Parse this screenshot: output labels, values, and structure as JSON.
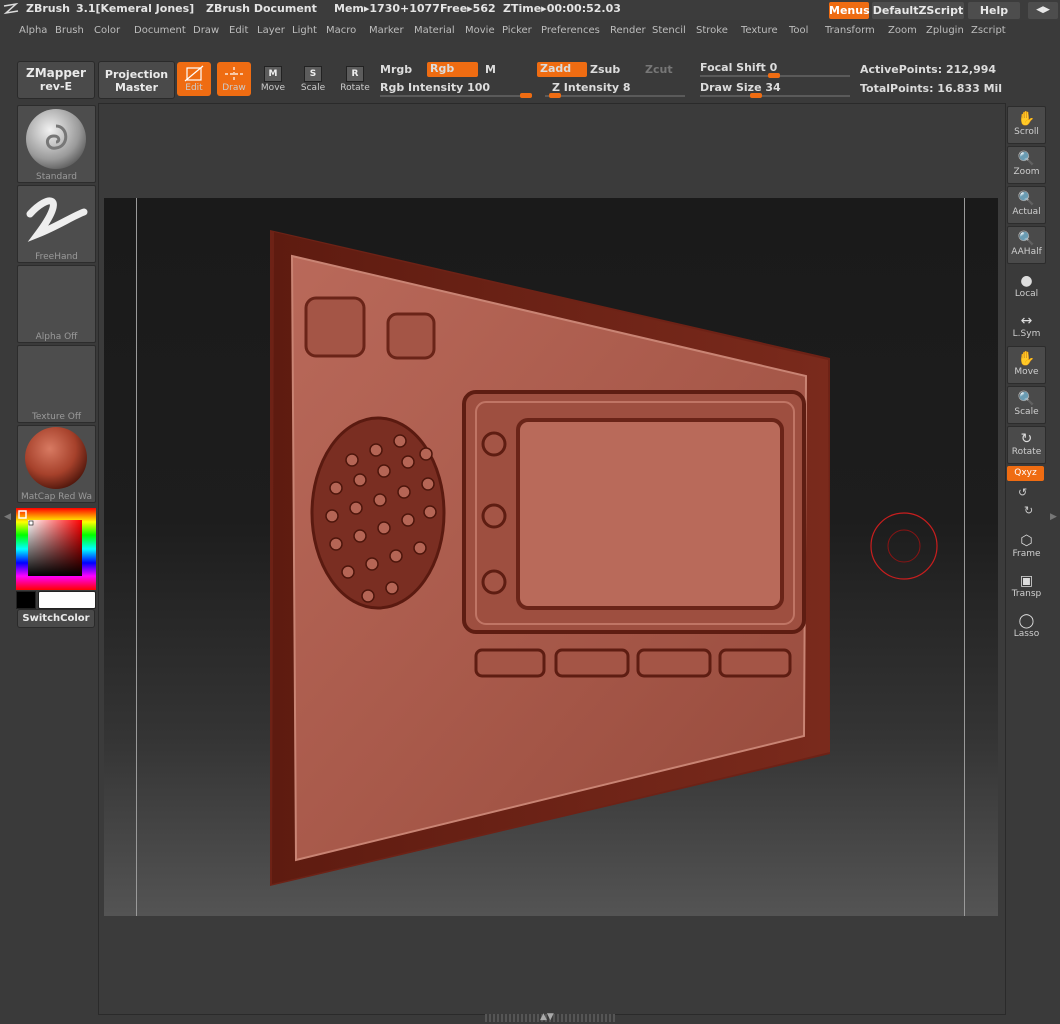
{
  "titlebar": {
    "app": "ZBrush",
    "version": "3.1[Kemeral Jones]",
    "document": "ZBrush Document",
    "mem": "Mem▸1730+1077",
    "free": "Free▸562",
    "ztime": "ZTime▸00:00:52.03",
    "menus_btn": "Menus",
    "script_btn": "DefaultZScript",
    "help_btn": "Help"
  },
  "menubar": [
    "Alpha",
    "Brush",
    "Color",
    "Document",
    "Draw",
    "Edit",
    "Layer",
    "Light",
    "Macro",
    "Marker",
    "Material",
    "Movie",
    "Picker",
    "Preferences",
    "Render",
    "Stencil",
    "Stroke",
    "Texture",
    "Tool",
    "Transform",
    "Zoom",
    "Zplugin",
    "Zscript"
  ],
  "shelf": {
    "zmapper_title": "ZMapper",
    "zmapper_sub": "rev-E",
    "projection_title": "Projection",
    "projection_sub": "Master",
    "edit": "Edit",
    "draw": "Draw",
    "move": "Move",
    "scale": "Scale",
    "rotate": "Rotate",
    "mrgb": "Mrgb",
    "rgb": "Rgb",
    "m": "M",
    "zadd": "Zadd",
    "zsub": "Zsub",
    "zcut": "Zcut",
    "rgb_intensity": "Rgb Intensity 100",
    "z_intensity": "Z Intensity 8",
    "focal_shift": "Focal Shift 0",
    "draw_size": "Draw Size 34",
    "active_points": "ActivePoints: 212,994",
    "total_points": "TotalPoints: 16.833 Mil"
  },
  "left_panel": {
    "brush": "Standard",
    "stroke": "FreeHand",
    "alpha": "Alpha Off",
    "texture": "Texture Off",
    "material": "MatCap Red Wa",
    "switch_color": "SwitchColor"
  },
  "right_panel": [
    "Scroll",
    "Zoom",
    "Actual",
    "AAHalf",
    "Local",
    "L.Sym",
    "Move",
    "Scale",
    "Rotate",
    "Frame",
    "Transp",
    "Lasso"
  ],
  "right_xyz": "Qxyz",
  "colors": {
    "accent": "#ef6c12",
    "material": "#a6412b",
    "brush_cursor": "#c81e1e"
  }
}
